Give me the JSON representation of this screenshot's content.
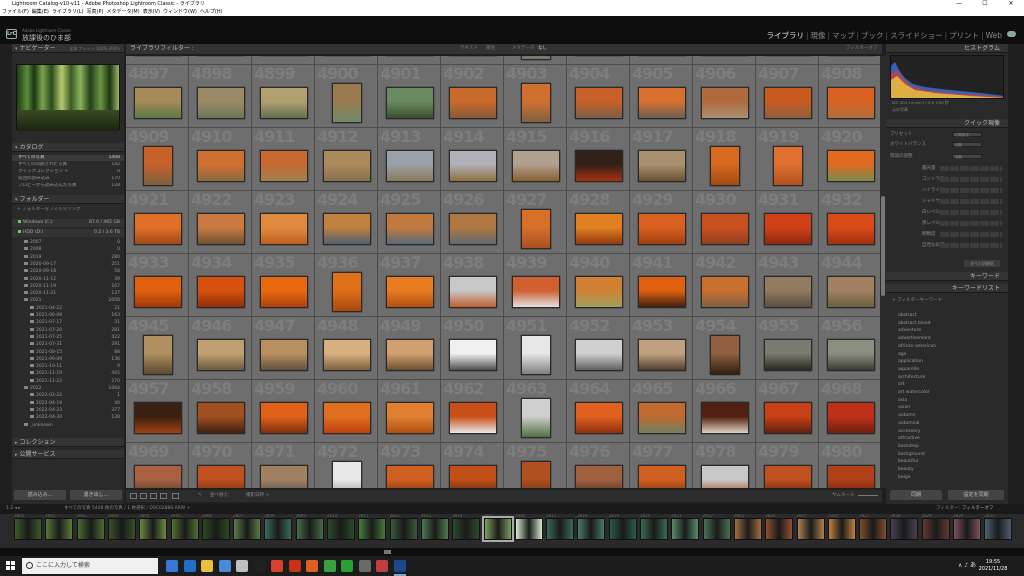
{
  "window": {
    "title": "Lightroom Catalog-v10-v11 - Adobe Photoshop Lightroom Classic - ライブラリ",
    "controls": {
      "minimize": "—",
      "maximize": "☐",
      "close": "✕"
    }
  },
  "menu": [
    "ファイル(F)",
    "編集(E)",
    "ライブラリ(L)",
    "写真(P)",
    "メタデータ(M)",
    "表示(V)",
    "ウィンドウ(W)",
    "ヘルプ(H)"
  ],
  "identity": {
    "logo": "LrC",
    "subtitle": "Adobe Lightroom Classic",
    "name": "放課後のひま部"
  },
  "modules": [
    {
      "label": "ライブラリ",
      "active": true
    },
    {
      "label": "現像",
      "active": false
    },
    {
      "label": "マップ",
      "active": false
    },
    {
      "label": "ブック",
      "active": false
    },
    {
      "label": "スライドショー",
      "active": false
    },
    {
      "label": "プリント",
      "active": false
    },
    {
      "label": "Web",
      "active": false
    }
  ],
  "module_separator": "|",
  "left": {
    "navigator": {
      "title": "ナビゲーター",
      "zoom": "全体  フィット  100%  300%"
    },
    "catalog": {
      "title": "カタログ",
      "items": [
        {
          "label": "すべての写真",
          "count": "5408"
        },
        {
          "label": "すべての同期された写真",
          "count": "142"
        },
        {
          "label": "クイックコレクション +",
          "count": "0"
        },
        {
          "label": "前回の読み込み",
          "count": "170"
        },
        {
          "label": "プロビーから読み込んだ写真",
          "count": "128"
        }
      ]
    },
    "folders": {
      "title": "フォルダー",
      "filter": "フォルダーをフィルタリング",
      "volumes": [
        {
          "label": "Windows (C:)",
          "info": "87.6 / 465 GB"
        },
        {
          "label": "HDD (D:)",
          "info": "0.2 / 3.6 TB"
        }
      ],
      "dirs": [
        {
          "label": "2007",
          "count": "0",
          "indent": 1
        },
        {
          "label": "2008",
          "count": "0",
          "indent": 1
        },
        {
          "label": "2019",
          "count": "280",
          "indent": 1
        },
        {
          "label": "2020-09-17",
          "count": "251",
          "indent": 1
        },
        {
          "label": "2020-09-18",
          "count": "58",
          "indent": 1
        },
        {
          "label": "2020-11-12",
          "count": "39",
          "indent": 1
        },
        {
          "label": "2020-11-19",
          "count": "167",
          "indent": 1
        },
        {
          "label": "2020-11-21",
          "count": "137",
          "indent": 1
        },
        {
          "label": "2021",
          "count": "2008",
          "indent": 1
        },
        {
          "label": "2021-04-22",
          "count": "21",
          "indent": 2
        },
        {
          "label": "2021-06-09",
          "count": "163",
          "indent": 2
        },
        {
          "label": "2021-07-17",
          "count": "31",
          "indent": 2
        },
        {
          "label": "2021-07-20",
          "count": "281",
          "indent": 2
        },
        {
          "label": "2021-07-25",
          "count": "422",
          "indent": 2
        },
        {
          "label": "2021-07-31",
          "count": "291",
          "indent": 2
        },
        {
          "label": "2021-08-15",
          "count": "88",
          "indent": 2
        },
        {
          "label": "2021-09-09",
          "count": "136",
          "indent": 2
        },
        {
          "label": "2021-10-11",
          "count": "0",
          "indent": 2
        },
        {
          "label": "2021-11-19",
          "count": "465",
          "indent": 2
        },
        {
          "label": "2021-11-22",
          "count": "270",
          "indent": 2
        },
        {
          "label": "2022",
          "count": "1064",
          "indent": 1
        },
        {
          "label": "2022-02-22",
          "count": "1",
          "indent": 2
        },
        {
          "label": "2022-04-19",
          "count": "40",
          "indent": 2
        },
        {
          "label": "2022-04-23",
          "count": "377",
          "indent": 2
        },
        {
          "label": "2022-04-30",
          "count": "138",
          "indent": 2
        },
        {
          "label": "_unknown",
          "count": "",
          "indent": 1
        }
      ]
    },
    "collections": "コレクション",
    "publish": "公開サービス",
    "buttons": {
      "import": "読み込み...",
      "export": "書き出し..."
    }
  },
  "filterbar": {
    "title": "ライブラリフィルター :",
    "options": [
      "テキスト",
      "属性",
      "メタデータ",
      "なし"
    ],
    "preset": "フィルターオフ"
  },
  "grid": {
    "cells": [
      {
        "n": "",
        "c": [
          "#5a5a5a",
          "#7a7a70"
        ]
      },
      {
        "n": "",
        "c": [
          "#888",
          "#666"
        ]
      },
      {
        "n": "",
        "c": [
          "#6a6a60",
          "#555"
        ]
      },
      {
        "n": "",
        "c": [
          "#777",
          "#555"
        ]
      },
      {
        "n": "",
        "c": [
          "#556",
          "#888"
        ]
      },
      {
        "n": "",
        "c": [
          "#887",
          "#665"
        ]
      },
      {
        "n": "",
        "c": [
          "#998",
          "#776"
        ]
      },
      {
        "n": "",
        "c": [
          "#aaa",
          "#888"
        ]
      },
      {
        "n": "",
        "c": [
          "#666",
          "#444"
        ]
      },
      {
        "n": "",
        "c": [
          "#777",
          "#555"
        ]
      },
      {
        "n": "",
        "c": [
          "#999",
          "#777"
        ]
      },
      {
        "n": "",
        "c": [
          "#888",
          "#555"
        ]
      },
      {
        "n": "4897",
        "c": [
          "#a58a58",
          "#5d7a4a"
        ]
      },
      {
        "n": "4898",
        "c": [
          "#9a8a66",
          "#6a7858"
        ]
      },
      {
        "n": "4899",
        "c": [
          "#b0a070",
          "#607050"
        ]
      },
      {
        "n": "4900",
        "c": [
          "#9a7a50",
          "#708a68"
        ]
      },
      {
        "n": "4901",
        "c": [
          "#6a8a60",
          "#3a5030"
        ]
      },
      {
        "n": "4902",
        "c": [
          "#c86a2a",
          "#8a5a3a"
        ]
      },
      {
        "n": "4903",
        "c": [
          "#d07030",
          "#806040"
        ]
      },
      {
        "n": "4904",
        "c": [
          "#c8602a",
          "#7a6048"
        ]
      },
      {
        "n": "4905",
        "c": [
          "#d87030",
          "#6a6050"
        ]
      },
      {
        "n": "4906",
        "c": [
          "#b06a40",
          "#a89070"
        ]
      },
      {
        "n": "4907",
        "c": [
          "#c85a20",
          "#906040"
        ]
      },
      {
        "n": "4908",
        "c": [
          "#d86020",
          "#b07040"
        ]
      },
      {
        "n": "4909",
        "c": [
          "#c8602a",
          "#7a6040"
        ]
      },
      {
        "n": "4910",
        "c": [
          "#d07030",
          "#8a6a40"
        ]
      },
      {
        "n": "4911",
        "c": [
          "#c86830",
          "#a08050"
        ]
      },
      {
        "n": "4912",
        "c": [
          "#aa8a5a",
          "#887050"
        ]
      },
      {
        "n": "4913",
        "c": [
          "#9aa0a8",
          "#8a7a5a"
        ]
      },
      {
        "n": "4914",
        "c": [
          "#b0b0b8",
          "#907040"
        ]
      },
      {
        "n": "4915",
        "c": [
          "#b0a090",
          "#8a6030"
        ]
      },
      {
        "n": "4916",
        "c": [
          "#302018",
          "#a83010"
        ]
      },
      {
        "n": "4917",
        "c": [
          "#a89070",
          "#6a5030"
        ]
      },
      {
        "n": "4918",
        "c": [
          "#d86a20",
          "#a04a10"
        ]
      },
      {
        "n": "4919",
        "c": [
          "#e07030",
          "#b05020"
        ]
      },
      {
        "n": "4920",
        "c": [
          "#e06a20",
          "#7a8a50"
        ]
      },
      {
        "n": "4921",
        "c": [
          "#e07028",
          "#a04818"
        ]
      },
      {
        "n": "4922",
        "c": [
          "#c87a40",
          "#705030"
        ]
      },
      {
        "n": "4923",
        "c": [
          "#e08a40",
          "#c06020"
        ]
      },
      {
        "n": "4924",
        "c": [
          "#c08040",
          "#506070"
        ]
      },
      {
        "n": "4925",
        "c": [
          "#c07a40",
          "#5a6a7a"
        ]
      },
      {
        "n": "4926",
        "c": [
          "#b07840",
          "#606a70"
        ]
      },
      {
        "n": "4927",
        "c": [
          "#d8702a",
          "#a85020"
        ]
      },
      {
        "n": "4928",
        "c": [
          "#e08020",
          "#903a10"
        ]
      },
      {
        "n": "4929",
        "c": [
          "#d86020",
          "#a04010"
        ]
      },
      {
        "n": "4930",
        "c": [
          "#c85020",
          "#904020"
        ]
      },
      {
        "n": "4931",
        "c": [
          "#d04018",
          "#902a10"
        ]
      },
      {
        "n": "4932",
        "c": [
          "#d84a18",
          "#a03010"
        ]
      },
      {
        "n": "4933",
        "c": [
          "#e06010",
          "#a03808"
        ]
      },
      {
        "n": "4934",
        "c": [
          "#d85010",
          "#903008"
        ]
      },
      {
        "n": "4935",
        "c": [
          "#e86a10",
          "#b04010"
        ]
      },
      {
        "n": "4936",
        "c": [
          "#e07018",
          "#a84810"
        ]
      },
      {
        "n": "4937",
        "c": [
          "#e87a20",
          "#b05010"
        ]
      },
      {
        "n": "4938",
        "c": [
          "#c8c8c8",
          "#c06030"
        ]
      },
      {
        "n": "4939",
        "c": [
          "#d06030",
          "#e0e0e0"
        ]
      },
      {
        "n": "4940",
        "c": [
          "#d08030",
          "#a0a060"
        ]
      },
      {
        "n": "4941",
        "c": [
          "#e06010",
          "#402010"
        ]
      },
      {
        "n": "4942",
        "c": [
          "#c87030",
          "#806040"
        ]
      },
      {
        "n": "4943",
        "c": [
          "#907a60",
          "#5a5040"
        ]
      },
      {
        "n": "4944",
        "c": [
          "#a08060",
          "#6a6040"
        ]
      },
      {
        "n": "4945",
        "c": [
          "#b09060",
          "#5a4a30"
        ]
      },
      {
        "n": "4946",
        "c": [
          "#c0a070",
          "#6a5a40"
        ]
      },
      {
        "n": "4947",
        "c": [
          "#b89060",
          "#605040"
        ]
      },
      {
        "n": "4948",
        "c": [
          "#d8b080",
          "#806040"
        ]
      },
      {
        "n": "4949",
        "c": [
          "#d0a070",
          "#6a5030"
        ]
      },
      {
        "n": "4950",
        "c": [
          "#f0f0f0",
          "#505050"
        ]
      },
      {
        "n": "4951",
        "c": [
          "#e8e8e8",
          "#808080"
        ]
      },
      {
        "n": "4952",
        "c": [
          "#d0d0d0",
          "#606060"
        ]
      },
      {
        "n": "4953",
        "c": [
          "#c0a080",
          "#504030"
        ]
      },
      {
        "n": "4954",
        "c": [
          "#906040",
          "#302010"
        ]
      },
      {
        "n": "4955",
        "c": [
          "#7a7a70",
          "#2a2a20"
        ]
      },
      {
        "n": "4956",
        "c": [
          "#8a9080",
          "#3a3a30"
        ]
      },
      {
        "n": "4957",
        "c": [
          "#3a2010",
          "#a04010"
        ]
      },
      {
        "n": "4958",
        "c": [
          "#a05020",
          "#402010"
        ]
      },
      {
        "n": "4959",
        "c": [
          "#e06018",
          "#803010"
        ]
      },
      {
        "n": "4960",
        "c": [
          "#e07020",
          "#c04010"
        ]
      },
      {
        "n": "4961",
        "c": [
          "#e08030",
          "#b05010"
        ]
      },
      {
        "n": "4962",
        "c": [
          "#c85018",
          "#e8e8e8"
        ]
      },
      {
        "n": "4963",
        "c": [
          "#d0d0d0",
          "#507040"
        ]
      },
      {
        "n": "4964",
        "c": [
          "#e06020",
          "#903010"
        ]
      },
      {
        "n": "4965",
        "c": [
          "#c06a30",
          "#708060"
        ]
      },
      {
        "n": "4966",
        "c": [
          "#502010",
          "#e0d0c0"
        ]
      },
      {
        "n": "4967",
        "c": [
          "#c84018",
          "#602010"
        ]
      },
      {
        "n": "4968",
        "c": [
          "#c03018",
          "#702010"
        ]
      },
      {
        "n": "4969",
        "c": [
          "#a86040",
          "#504030"
        ]
      },
      {
        "n": "4970",
        "c": [
          "#c05020",
          "#703010"
        ]
      },
      {
        "n": "4971",
        "c": [
          "#a08060",
          "#505050"
        ]
      },
      {
        "n": "4972",
        "c": [
          "#e8e8e8",
          "#909090"
        ]
      },
      {
        "n": "4973",
        "c": [
          "#d06020",
          "#803010"
        ]
      },
      {
        "n": "4974",
        "c": [
          "#c05018",
          "#602010"
        ]
      },
      {
        "n": "4975",
        "c": [
          "#b05020",
          "#603010"
        ]
      },
      {
        "n": "4976",
        "c": [
          "#a06040",
          "#503020"
        ]
      },
      {
        "n": "4977",
        "c": [
          "#d06020",
          "#803010"
        ]
      },
      {
        "n": "4978",
        "c": [
          "#c8c8c8",
          "#a05020"
        ]
      },
      {
        "n": "4979",
        "c": [
          "#c05020",
          "#602010"
        ]
      },
      {
        "n": "4980",
        "c": [
          "#b04018",
          "#702010"
        ]
      }
    ]
  },
  "toolbar": {
    "sort_label": "並べ替え:",
    "sort_value": "撮影日時 ÷",
    "thumb_label": "サムネール"
  },
  "filmstrip": {
    "nav": "1  2  ◂  ▸",
    "source": "すべての写真  5408 枚の写真 / 1 枚選択 / DSC02880.ARW ÷",
    "filter": "フィルター:",
    "filter_value": "フィルターオフ",
    "nums": [
      "2800",
      "2801",
      "2802",
      "2803",
      "2804",
      "2805",
      "2806",
      "2807",
      "2808",
      "2809",
      "2810",
      "2811",
      "2812",
      "2813",
      "2814",
      "2815",
      "2816",
      "2817",
      "2818",
      "2819",
      "2820",
      "2821",
      "2822",
      "2823",
      "2824",
      "2825",
      "2826",
      "2827",
      "2828",
      "2829",
      "2830",
      "2831"
    ],
    "thumbs": [
      "#3a5a2a",
      "#5a7a3a",
      "#4a6a30",
      "#3a5028",
      "#6a8a40",
      "#507030",
      "#2a4a20",
      "#5a7a48",
      "#3a6a5a",
      "#4a6a48",
      "#2a4a2a",
      "#4a7a3a",
      "#3a5a3a",
      "#507a50",
      "#2a4a30",
      "#7aa060",
      "#d8e8d0",
      "#3a6a5a",
      "#4a7a6a",
      "#2a5a4a",
      "#3a6a50",
      "#5a8a6a",
      "#4a7058",
      "#a07040",
      "#905030",
      "#b08050",
      "#c08040",
      "#805030",
      "#4a4050",
      "#603a30",
      "#7a5060",
      "#506070"
    ]
  },
  "right": {
    "histogram": {
      "title": "ヒストグラム",
      "info": "ISO 400   14 mm   f / 5.6   1/50 秒",
      "sub": "元の写真"
    },
    "quick_develop": {
      "title": "クイック現像",
      "preset": {
        "label": "プリセット",
        "value": "初期設定"
      },
      "wb": {
        "label": "ホワイトバランス",
        "value": "自動"
      },
      "tone": {
        "label": "階調の調整",
        "value": "自動"
      },
      "rows": [
        "露光量",
        "コントラスト",
        "ハイライト",
        "シャドウ",
        "白レベル",
        "黒レベル",
        "明瞭度",
        "自然な彩度"
      ],
      "reset": "すべて初期化"
    },
    "keyword_title": "キーワード",
    "keyword_list": {
      "title": "キーワードリスト",
      "filter": "フィルターキーワード",
      "items": [
        "abstract",
        "abstract blood",
        "adventure",
        "advertisement",
        "african american",
        "age",
        "application",
        "aquarelle",
        "architecture",
        "art",
        "art watercolor",
        "asia",
        "asian",
        "autumn",
        "autumnal",
        "accessory",
        "attractive",
        "backdrop",
        "background",
        "beautiful",
        "beauty",
        "beige"
      ]
    },
    "buttons": {
      "sync": "同期",
      "sync_settings": "設定を同期"
    }
  },
  "taskbar": {
    "search_placeholder": "ここに入力して検索",
    "time": "19:55",
    "date": "2021/11/28",
    "tray": "∧  ♪  あ",
    "icons": [
      "#3a78d8",
      "#1f6fc4",
      "#e8c040",
      "#4a8ad8",
      "#c0c0c0",
      "#202020",
      "#d84030",
      "#c83018",
      "#e06020",
      "#3aa040",
      "#2aa030",
      "#6a6a6a",
      "#c04040",
      "#1a4a8a"
    ]
  }
}
